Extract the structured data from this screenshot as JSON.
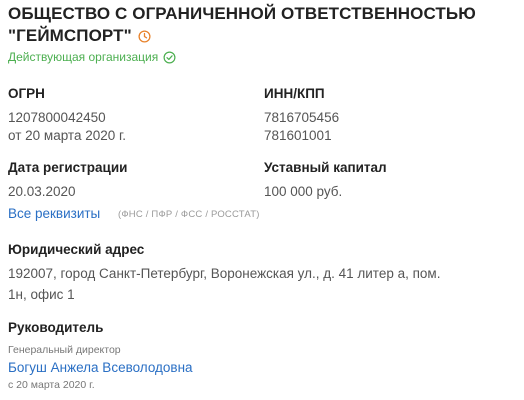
{
  "company": {
    "title_line1": "ОБЩЕСТВО С ОГРАНИЧЕННОЙ ОТВЕТСТВЕННОСТЬЮ",
    "title_line2": "\"ГЕЙМСПОРТ\"",
    "status": "Действующая организация"
  },
  "ogrn": {
    "label": "ОГРН",
    "value": "1207800042450",
    "date": "от 20 марта 2020 г."
  },
  "inn_kpp": {
    "label": "ИНН/КПП",
    "inn": "7816705456",
    "kpp": "781601001"
  },
  "registration": {
    "label": "Дата регистрации",
    "value": "20.03.2020"
  },
  "capital": {
    "label": "Уставный капитал",
    "value": "100 000 руб."
  },
  "requisites": {
    "link": "Все реквизиты",
    "sources": "(ФНС / ПФР / ФСС / РОССТАТ)"
  },
  "address": {
    "label": "Юридический адрес",
    "line1": "192007, город Санкт-Петербург, Воронежская ул., д. 41 литер а, пом.",
    "line2": "1н, офис 1"
  },
  "director": {
    "label": "Руководитель",
    "position": "Генеральный директор",
    "name": "Богуш Анжела Всеволодовна",
    "since": "с 20 марта 2020 г."
  },
  "colors": {
    "status_green": "#4caf50",
    "link_blue": "#2a6fc4",
    "clock_orange": "#e8822b"
  },
  "icons": [
    "clock-icon",
    "check-circle-icon"
  ]
}
